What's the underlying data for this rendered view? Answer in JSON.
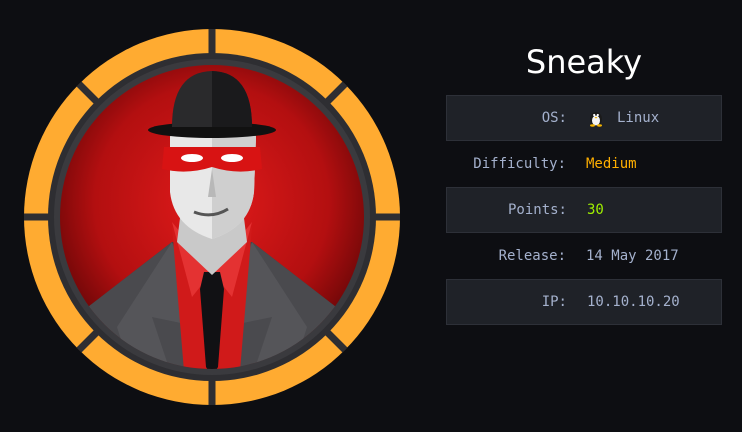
{
  "machine": {
    "name": "Sneaky",
    "avatar_icon": "hat-man-avatar-icon",
    "ring_color": "#ffab31"
  },
  "info": [
    {
      "label": "OS:",
      "value": "Linux",
      "icon": "linux-penguin-icon"
    },
    {
      "label": "Difficulty:",
      "value": "Medium",
      "color": "#ffaf00"
    },
    {
      "label": "Points:",
      "value": "30",
      "color": "#9fef00"
    },
    {
      "label": "Release:",
      "value": "14 May 2017"
    },
    {
      "label": "IP:",
      "value": "10.10.10.20"
    }
  ]
}
